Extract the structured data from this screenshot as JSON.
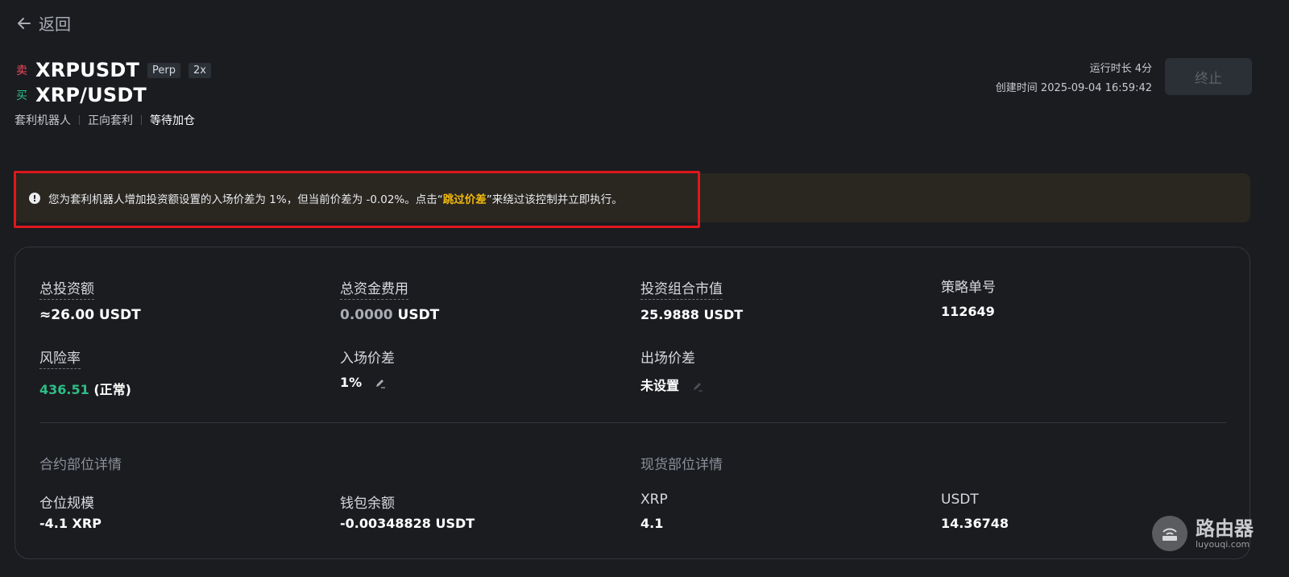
{
  "back": {
    "label": "返回"
  },
  "header": {
    "sell_tag": "卖",
    "buy_tag": "买",
    "perp_pair": "XRPUSDT",
    "perp_tag": "Perp",
    "leverage_tag": "2x",
    "spot_pair": "XRP/USDT",
    "meta": [
      "套利机器人",
      "正向套利",
      "等待加仓"
    ],
    "runtime": "运行时长 4分",
    "created": "创建时间 2025-09-04 16:59:42",
    "stop_label": "终止"
  },
  "warning": {
    "text_before": "您为套利机器人增加投资额设置的入场价差为 1%，但当前价差为 -0.02%。点击“",
    "highlight": "跳过价差",
    "text_after": "”来绕过该控制并立即执行。"
  },
  "stats": {
    "total_invest_label": "总投资额",
    "total_invest_value": "≈26.00 USDT",
    "total_fee_label": "总资金费用",
    "total_fee_num": "0.0000",
    "total_fee_unit": " USDT",
    "portfolio_label": "投资组合市值",
    "portfolio_value": "25.9888 USDT",
    "strategy_id_label": "策略单号",
    "strategy_id_value": "112649",
    "risk_label": "风险率",
    "risk_num": "436.51",
    "risk_status": " (正常)",
    "entry_spread_label": "入场价差",
    "entry_spread_value": "1%",
    "exit_spread_label": "出场价差",
    "exit_spread_value": "未设置"
  },
  "positions": {
    "futures_title": "合约部位详情",
    "spot_title": "现货部位详情",
    "position_size_label": "仓位规模",
    "position_size_value": "-4.1 XRP",
    "wallet_label": "钱包余额",
    "wallet_value": "-0.00348828 USDT",
    "xrp_label": "XRP",
    "xrp_value": "4.1",
    "usdt_label": "USDT",
    "usdt_value": "14.36748"
  },
  "watermark": {
    "title": "路由器",
    "sub": "luyouqi.com"
  },
  "colors": {
    "sell": "#f6465d",
    "buy": "#2ebd85",
    "highlight": "#f0b90b",
    "alert_border": "#e0171b"
  }
}
